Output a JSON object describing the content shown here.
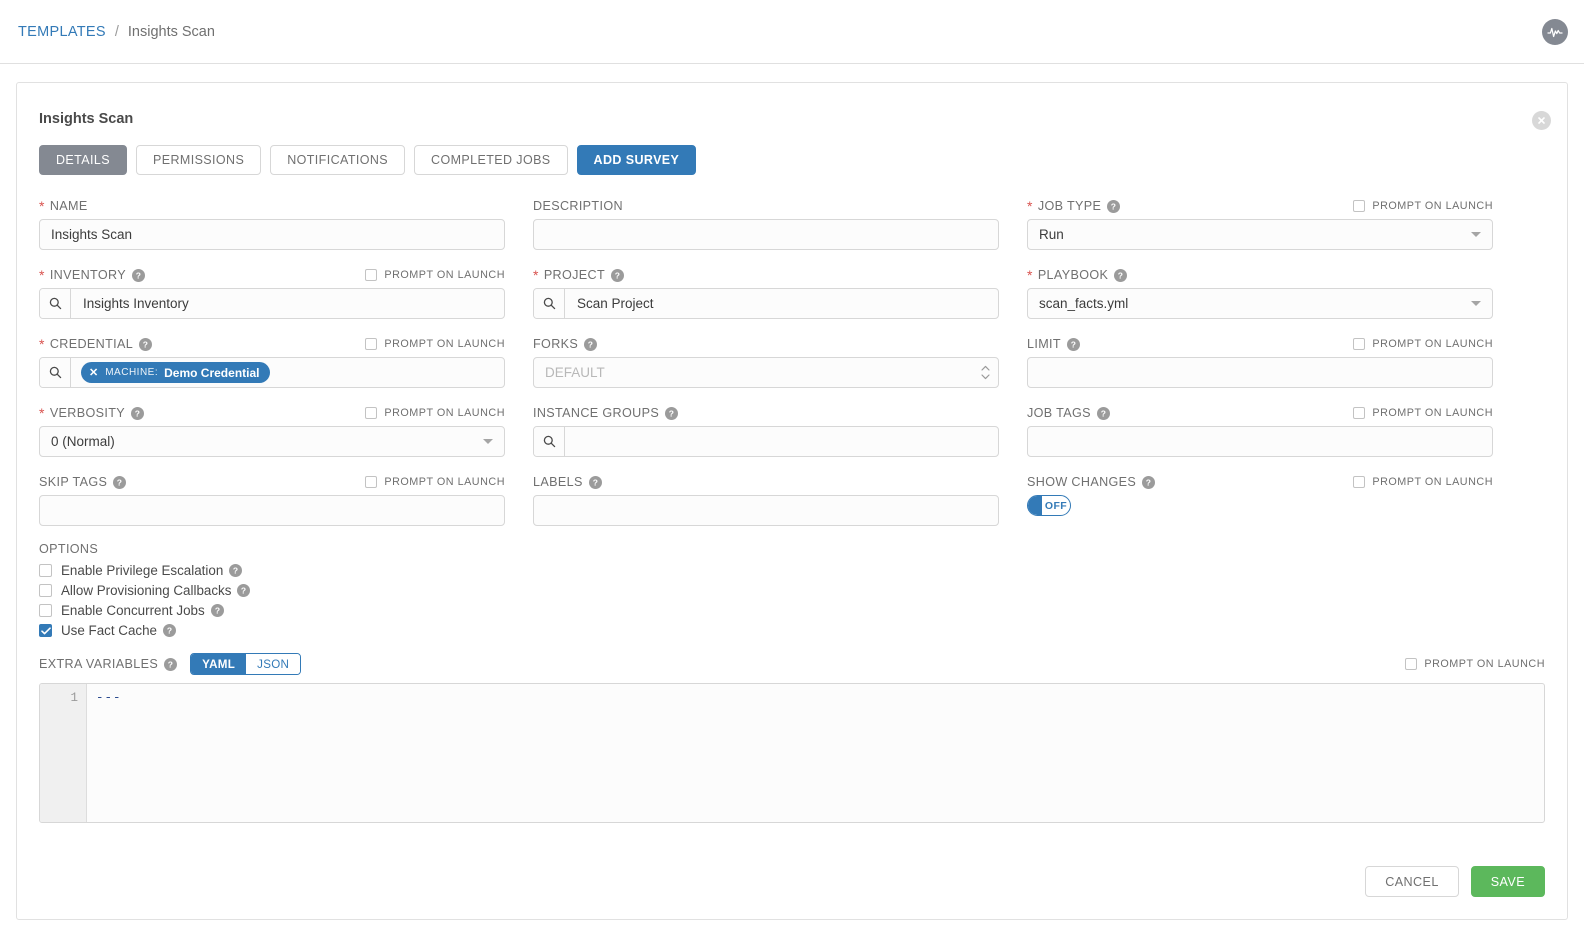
{
  "breadcrumb": {
    "root": "TEMPLATES",
    "separator": "/",
    "current": "Insights Scan"
  },
  "header": {
    "activity_icon": "activity-stream-icon"
  },
  "card": {
    "title": "Insights Scan",
    "close_icon": "close-icon"
  },
  "tabs": [
    {
      "label": "DETAILS",
      "state": "active"
    },
    {
      "label": "PERMISSIONS",
      "state": "outline"
    },
    {
      "label": "NOTIFICATIONS",
      "state": "outline"
    },
    {
      "label": "COMPLETED JOBS",
      "state": "outline"
    },
    {
      "label": "ADD SURVEY",
      "state": "primary"
    }
  ],
  "prompt_on_launch_label": "PROMPT ON LAUNCH",
  "fields": {
    "name": {
      "label": "NAME",
      "value": "Insights Scan"
    },
    "description": {
      "label": "DESCRIPTION",
      "value": ""
    },
    "job_type": {
      "label": "JOB TYPE",
      "value": "Run"
    },
    "inventory": {
      "label": "INVENTORY",
      "value": "Insights Inventory"
    },
    "project": {
      "label": "PROJECT",
      "value": "Scan Project"
    },
    "playbook": {
      "label": "PLAYBOOK",
      "value": "scan_facts.yml"
    },
    "credential": {
      "label": "CREDENTIAL",
      "chip_kind": "MACHINE:",
      "chip_value": "Demo Credential"
    },
    "forks": {
      "label": "FORKS",
      "placeholder": "DEFAULT",
      "value": ""
    },
    "limit": {
      "label": "LIMIT",
      "value": ""
    },
    "verbosity": {
      "label": "VERBOSITY",
      "value": "0 (Normal)"
    },
    "instance_groups": {
      "label": "INSTANCE GROUPS",
      "value": ""
    },
    "job_tags": {
      "label": "JOB TAGS",
      "value": ""
    },
    "skip_tags": {
      "label": "SKIP TAGS",
      "value": ""
    },
    "labels": {
      "label": "LABELS",
      "value": ""
    },
    "show_changes": {
      "label": "SHOW CHANGES",
      "toggle_state": "OFF"
    }
  },
  "options": {
    "title": "OPTIONS",
    "items": [
      {
        "label": "Enable Privilege Escalation",
        "checked": false
      },
      {
        "label": "Allow Provisioning Callbacks",
        "checked": false
      },
      {
        "label": "Enable Concurrent Jobs",
        "checked": false
      },
      {
        "label": "Use Fact Cache",
        "checked": true
      }
    ]
  },
  "extra_variables": {
    "label": "EXTRA VARIABLES",
    "format_yaml": "YAML",
    "format_json": "JSON",
    "active_format": "YAML",
    "line_number": "1",
    "content": "---"
  },
  "footer": {
    "cancel": "CANCEL",
    "save": "SAVE"
  },
  "colors": {
    "primary_blue": "#337ab7",
    "save_green": "#5cb85c",
    "required_red": "#d9534f",
    "tab_active_gray": "#848992"
  }
}
